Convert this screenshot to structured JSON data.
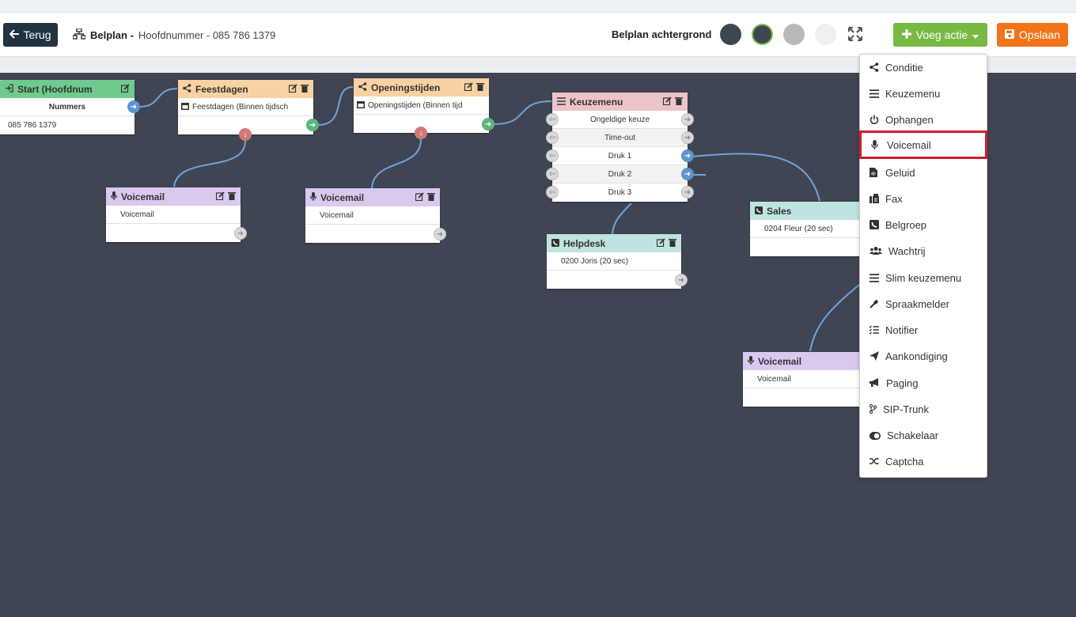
{
  "toolbar": {
    "back_label": "Terug",
    "title_bold": "Belplan -",
    "title_rest": "Hoofdnummer - 085 786 1379",
    "bg_label": "Belplan achtergrond",
    "swatches": [
      "#3d4754",
      "#3d4754",
      "#b9b9b9",
      "#eef0f3"
    ],
    "add_label": "Voeg actie",
    "save_label": "Opslaan"
  },
  "nodes": {
    "start": {
      "title": "Start (Hoofdnum",
      "rows": [
        "Nummers",
        "085 786 1379"
      ]
    },
    "feestdagen": {
      "title": "Feestdagen",
      "rows": [
        "Feestdagen (Binnen tijdsch"
      ]
    },
    "openingstijden": {
      "title": "Openingstijden",
      "rows": [
        "Openingstijden (Binnen tijd"
      ]
    },
    "keuzemenu": {
      "title": "Keuzemenu",
      "rows": [
        "Ongeldige keuze",
        "Time-out",
        "Druk 1",
        "Druk 2",
        "Druk 3"
      ]
    },
    "voicemail1": {
      "title": "Voicemail",
      "rows": [
        "Voicemail"
      ]
    },
    "voicemail2": {
      "title": "Voicemail",
      "rows": [
        "Voicemail"
      ]
    },
    "voicemail3": {
      "title": "Voicemail",
      "rows": [
        "Voicemail"
      ]
    },
    "helpdesk": {
      "title": "Helpdesk",
      "rows": [
        "0200 Joris (20 sec)"
      ]
    },
    "sales": {
      "title": "Sales",
      "rows": [
        "0204 Fleur (20 sec)"
      ]
    }
  },
  "menu": {
    "items": [
      {
        "label": "Conditie",
        "icon": "share-icon"
      },
      {
        "label": "Keuzemenu",
        "icon": "bars-icon"
      },
      {
        "label": "Ophangen",
        "icon": "power-icon"
      },
      {
        "label": "Voicemail",
        "icon": "microphone-icon",
        "highlighted": true
      },
      {
        "label": "Geluid",
        "icon": "audio-file-icon"
      },
      {
        "label": "Fax",
        "icon": "fax-icon"
      },
      {
        "label": "Belgroep",
        "icon": "phone-square-icon"
      },
      {
        "label": "Wachtrij",
        "icon": "users-icon"
      },
      {
        "label": "Slim keuzemenu",
        "icon": "bars-icon"
      },
      {
        "label": "Spraakmelder",
        "icon": "microphone-alt-icon"
      },
      {
        "label": "Notifier",
        "icon": "list-check-icon"
      },
      {
        "label": "Aankondiging",
        "icon": "paper-plane-icon"
      },
      {
        "label": "Paging",
        "icon": "bullhorn-icon"
      },
      {
        "label": "SIP-Trunk",
        "icon": "code-branch-icon"
      },
      {
        "label": "Schakelaar",
        "icon": "toggle-icon"
      },
      {
        "label": "Captcha",
        "icon": "random-icon"
      }
    ]
  },
  "colors": {
    "canvas": "#404553",
    "back_button": "#1f3440",
    "add_button": "#78b944",
    "save_button": "#f3731a",
    "highlight": "#cc1f2f",
    "wire": "#6fa3da"
  }
}
